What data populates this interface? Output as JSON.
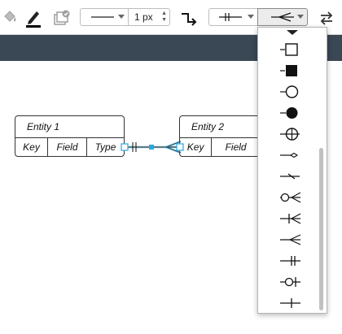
{
  "toolbar": {
    "fill_icon": "paint-bucket-icon",
    "line_color_icon": "pencil-icon",
    "shadow_icon": "shadow-checkbox-icon",
    "line_style_icon": "solid-line-icon",
    "line_width_value": "1 px",
    "waypoint_icon": "orthogonal-connector-icon",
    "start_arrow_icon": "er-mandatory-one-icon",
    "end_arrow_icon": "er-many-icon",
    "swap_icon": "swap-arrows-icon"
  },
  "canvas": {
    "entities": [
      {
        "title": "Entity 1",
        "fields": [
          "Key",
          "Field",
          "Type"
        ]
      },
      {
        "title": "Entity 2",
        "fields": [
          "Key",
          "Field"
        ]
      }
    ],
    "connector_selected": true
  },
  "end_arrow_menu": {
    "items": [
      {
        "name": "block-open-arrow-icon"
      },
      {
        "name": "block-filled-arrow-icon"
      },
      {
        "name": "oval-open-arrow-icon"
      },
      {
        "name": "oval-filled-arrow-icon"
      },
      {
        "name": "cross-circle-arrow-icon"
      },
      {
        "name": "diamond-thin-arrow-icon"
      },
      {
        "name": "dash-arrow-icon"
      },
      {
        "name": "er-zero-to-many-icon"
      },
      {
        "name": "er-one-to-many-icon"
      },
      {
        "name": "er-many-icon"
      },
      {
        "name": "er-mandatory-one-icon"
      },
      {
        "name": "er-zero-to-one-icon"
      },
      {
        "name": "er-one-icon"
      }
    ]
  },
  "colors": {
    "banner": "#3a4754",
    "selection": "#29a8e0",
    "text": "#111111"
  }
}
